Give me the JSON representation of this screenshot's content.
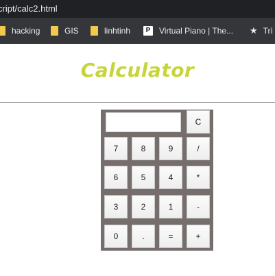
{
  "browser": {
    "url_fragment": "cript/calc2.html",
    "bookmarks": [
      {
        "label": "hacking",
        "icon": "folder-icon"
      },
      {
        "label": "GIS",
        "icon": "folder-icon"
      },
      {
        "label": "linhtinh",
        "icon": "folder-icon"
      },
      {
        "label": "Virtual Piano | The...",
        "icon": "page-icon",
        "icon_glyph": "P"
      },
      {
        "label": "Trì",
        "icon": "star-icon"
      }
    ]
  },
  "page": {
    "title": "Calculator"
  },
  "calculator": {
    "display_value": "",
    "keys": {
      "clear": "C",
      "row1": [
        "7",
        "8",
        "9",
        "/"
      ],
      "row2": [
        "6",
        "5",
        "4",
        "*"
      ],
      "row3": [
        "3",
        "2",
        "1",
        "-"
      ],
      "row4": [
        "0",
        ".",
        "=",
        "+"
      ]
    }
  },
  "colors": {
    "title": "#c5d53a",
    "calculator_frame": "#766d6d",
    "browser_bar": "#35363a"
  }
}
